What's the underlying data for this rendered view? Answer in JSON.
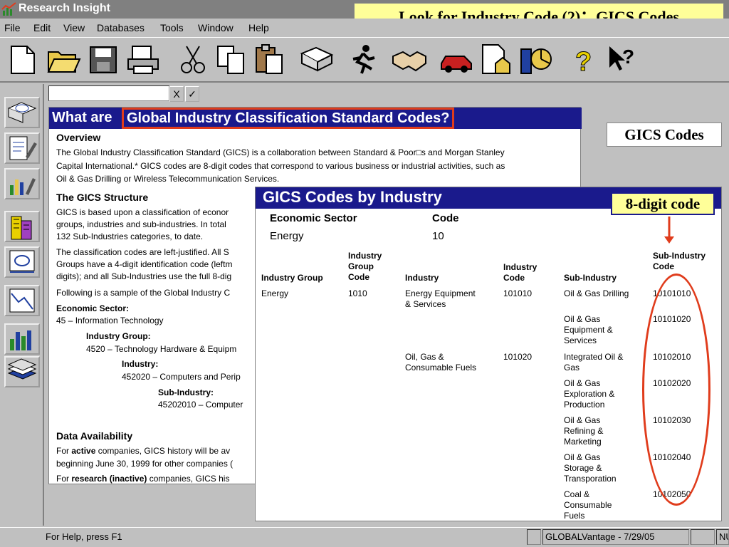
{
  "app": {
    "title": "Research Insight"
  },
  "callouts": {
    "title": "Look for Industry Code (2)：GICS Codes",
    "gics": "GICS Codes",
    "eight_digit": "8-digit code"
  },
  "menu": [
    "File",
    "Edit",
    "View",
    "Databases",
    "Tools",
    "Window",
    "Help"
  ],
  "toolbar_icons": [
    "new-document-icon",
    "open-folder-icon",
    "save-disk-icon",
    "print-icon",
    "cut-scissors-icon",
    "copy-icon",
    "paste-clipboard-icon",
    "book-icon",
    "runner-icon",
    "handshake-icon",
    "car-icon",
    "report-house-icon",
    "chart-book-icon",
    "help-question-icon",
    "context-help-icon"
  ],
  "left_icons": [
    "fli-book-icon",
    "document-pen-icon",
    "bar-chart-pen-icon",
    "building-icon",
    "fli-card-icon",
    "line-chart-doc-icon",
    "bar-chart-icon",
    "stacked-cards-icon"
  ],
  "formula": {
    "x_label": "X",
    "check_label": "✓"
  },
  "doc": {
    "heading_prefix": "What are",
    "heading_highlight": "Global Industry Classification Standard Codes?",
    "overview_title": "Overview",
    "overview_lines": [
      "The Global Industry Classification Standard (GICS) is a collaboration between Standard & Poor□s and Morgan Stanley",
      "Capital International.*  GICS codes are 8-digit codes that correspond to various business or industrial activities, such as",
      "Oil & Gas Drilling or Wireless Telecommunication Services."
    ],
    "structure_title": "The GICS Structure",
    "structure_lines": [
      "GICS is based upon a classification of econor",
      "groups, industries and sub-industries.  In total",
      "132 Sub-Industries categories, to date."
    ],
    "classification_lines": [
      "The classification codes are left-justified.  All S",
      "Groups have a 4-digit identification code (leftm",
      "digits); and all Sub-Industries use the full 8-dig"
    ],
    "sample_line": "Following is a sample of the Global Industry C",
    "econ_label": "Economic Sector:",
    "econ_value": "45 – Information Technology",
    "ig_label": "Industry Group:",
    "ig_value": "4520 – Technology Hardware & Equipm",
    "ind_label": "Industry:",
    "ind_value": "452020 – Computers and Perip",
    "sub_label": "Sub-Industry:",
    "sub_value": "45202010 – Computer",
    "avail_title": "Data Availability",
    "avail_line1_a": "For ",
    "avail_line1_b": "active",
    "avail_line1_c": " companies, GICS history will be av",
    "avail_line2": "beginning June 30, 1999 for other companies (",
    "avail_line3_a": "For ",
    "avail_line3_b": "research (inactive)",
    "avail_line3_c": " companies, GICS his"
  },
  "panel": {
    "title": "GICS Codes by Industry",
    "sector_header": "Economic Sector",
    "code_header": "Code",
    "sector_value": "Energy",
    "sector_code": "10",
    "col_headers": {
      "industry_group": "Industry Group",
      "industry_group_code": [
        "Industry",
        "Group",
        "Code"
      ],
      "industry": "Industry",
      "industry_code": [
        "Industry",
        "Code"
      ],
      "sub_industry": "Sub-Industry",
      "sub_industry_code": [
        "Sub-Industry",
        "Code"
      ]
    },
    "industry_group": "Energy",
    "industry_group_code": "1010",
    "industries": [
      {
        "name": [
          "Energy Equipment",
          "& Services"
        ],
        "code": "101010"
      },
      {
        "name": [
          "Oil, Gas &",
          "Consumable Fuels"
        ],
        "code": "101020"
      }
    ],
    "sub_industries": [
      {
        "name": [
          "Oil & Gas Drilling"
        ],
        "code": "10101010"
      },
      {
        "name": [
          "Oil & Gas",
          "Equipment &",
          "Services"
        ],
        "code": "10101020"
      },
      {
        "name": [
          "Integrated Oil &",
          "Gas"
        ],
        "code": "10102010"
      },
      {
        "name": [
          "Oil & Gas",
          "Exploration &",
          "Production"
        ],
        "code": "10102020"
      },
      {
        "name": [
          "Oil & Gas",
          "Refining &",
          "Marketing"
        ],
        "code": "10102030"
      },
      {
        "name": [
          "Oil & Gas",
          "Storage &",
          "Transporation"
        ],
        "code": "10102040"
      },
      {
        "name": [
          "Coal &",
          "Consumable",
          "Fuels"
        ],
        "code": "10102050"
      }
    ]
  },
  "status": {
    "help": "For Help, press F1",
    "cell1": "",
    "cell2": "GLOBALVantage - 7/29/05",
    "cell3": "",
    "cell4": "NU"
  }
}
